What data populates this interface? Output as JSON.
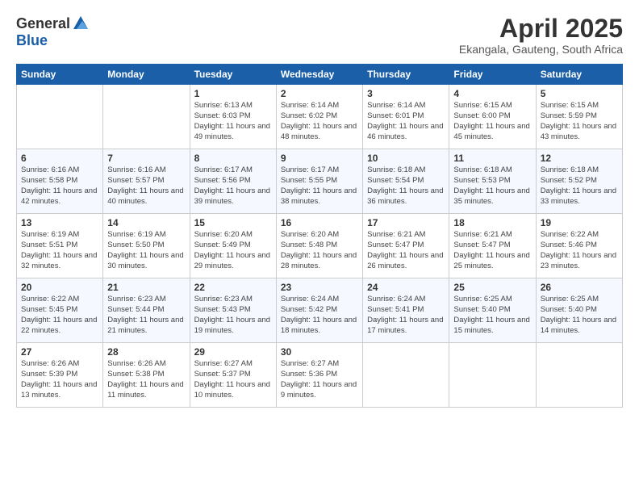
{
  "logo": {
    "general": "General",
    "blue": "Blue"
  },
  "header": {
    "title": "April 2025",
    "subtitle": "Ekangala, Gauteng, South Africa"
  },
  "days_of_week": [
    "Sunday",
    "Monday",
    "Tuesday",
    "Wednesday",
    "Thursday",
    "Friday",
    "Saturday"
  ],
  "weeks": [
    [
      {
        "day": "",
        "info": ""
      },
      {
        "day": "",
        "info": ""
      },
      {
        "day": "1",
        "info": "Sunrise: 6:13 AM\nSunset: 6:03 PM\nDaylight: 11 hours and 49 minutes."
      },
      {
        "day": "2",
        "info": "Sunrise: 6:14 AM\nSunset: 6:02 PM\nDaylight: 11 hours and 48 minutes."
      },
      {
        "day": "3",
        "info": "Sunrise: 6:14 AM\nSunset: 6:01 PM\nDaylight: 11 hours and 46 minutes."
      },
      {
        "day": "4",
        "info": "Sunrise: 6:15 AM\nSunset: 6:00 PM\nDaylight: 11 hours and 45 minutes."
      },
      {
        "day": "5",
        "info": "Sunrise: 6:15 AM\nSunset: 5:59 PM\nDaylight: 11 hours and 43 minutes."
      }
    ],
    [
      {
        "day": "6",
        "info": "Sunrise: 6:16 AM\nSunset: 5:58 PM\nDaylight: 11 hours and 42 minutes."
      },
      {
        "day": "7",
        "info": "Sunrise: 6:16 AM\nSunset: 5:57 PM\nDaylight: 11 hours and 40 minutes."
      },
      {
        "day": "8",
        "info": "Sunrise: 6:17 AM\nSunset: 5:56 PM\nDaylight: 11 hours and 39 minutes."
      },
      {
        "day": "9",
        "info": "Sunrise: 6:17 AM\nSunset: 5:55 PM\nDaylight: 11 hours and 38 minutes."
      },
      {
        "day": "10",
        "info": "Sunrise: 6:18 AM\nSunset: 5:54 PM\nDaylight: 11 hours and 36 minutes."
      },
      {
        "day": "11",
        "info": "Sunrise: 6:18 AM\nSunset: 5:53 PM\nDaylight: 11 hours and 35 minutes."
      },
      {
        "day": "12",
        "info": "Sunrise: 6:18 AM\nSunset: 5:52 PM\nDaylight: 11 hours and 33 minutes."
      }
    ],
    [
      {
        "day": "13",
        "info": "Sunrise: 6:19 AM\nSunset: 5:51 PM\nDaylight: 11 hours and 32 minutes."
      },
      {
        "day": "14",
        "info": "Sunrise: 6:19 AM\nSunset: 5:50 PM\nDaylight: 11 hours and 30 minutes."
      },
      {
        "day": "15",
        "info": "Sunrise: 6:20 AM\nSunset: 5:49 PM\nDaylight: 11 hours and 29 minutes."
      },
      {
        "day": "16",
        "info": "Sunrise: 6:20 AM\nSunset: 5:48 PM\nDaylight: 11 hours and 28 minutes."
      },
      {
        "day": "17",
        "info": "Sunrise: 6:21 AM\nSunset: 5:47 PM\nDaylight: 11 hours and 26 minutes."
      },
      {
        "day": "18",
        "info": "Sunrise: 6:21 AM\nSunset: 5:47 PM\nDaylight: 11 hours and 25 minutes."
      },
      {
        "day": "19",
        "info": "Sunrise: 6:22 AM\nSunset: 5:46 PM\nDaylight: 11 hours and 23 minutes."
      }
    ],
    [
      {
        "day": "20",
        "info": "Sunrise: 6:22 AM\nSunset: 5:45 PM\nDaylight: 11 hours and 22 minutes."
      },
      {
        "day": "21",
        "info": "Sunrise: 6:23 AM\nSunset: 5:44 PM\nDaylight: 11 hours and 21 minutes."
      },
      {
        "day": "22",
        "info": "Sunrise: 6:23 AM\nSunset: 5:43 PM\nDaylight: 11 hours and 19 minutes."
      },
      {
        "day": "23",
        "info": "Sunrise: 6:24 AM\nSunset: 5:42 PM\nDaylight: 11 hours and 18 minutes."
      },
      {
        "day": "24",
        "info": "Sunrise: 6:24 AM\nSunset: 5:41 PM\nDaylight: 11 hours and 17 minutes."
      },
      {
        "day": "25",
        "info": "Sunrise: 6:25 AM\nSunset: 5:40 PM\nDaylight: 11 hours and 15 minutes."
      },
      {
        "day": "26",
        "info": "Sunrise: 6:25 AM\nSunset: 5:40 PM\nDaylight: 11 hours and 14 minutes."
      }
    ],
    [
      {
        "day": "27",
        "info": "Sunrise: 6:26 AM\nSunset: 5:39 PM\nDaylight: 11 hours and 13 minutes."
      },
      {
        "day": "28",
        "info": "Sunrise: 6:26 AM\nSunset: 5:38 PM\nDaylight: 11 hours and 11 minutes."
      },
      {
        "day": "29",
        "info": "Sunrise: 6:27 AM\nSunset: 5:37 PM\nDaylight: 11 hours and 10 minutes."
      },
      {
        "day": "30",
        "info": "Sunrise: 6:27 AM\nSunset: 5:36 PM\nDaylight: 11 hours and 9 minutes."
      },
      {
        "day": "",
        "info": ""
      },
      {
        "day": "",
        "info": ""
      },
      {
        "day": "",
        "info": ""
      }
    ]
  ]
}
